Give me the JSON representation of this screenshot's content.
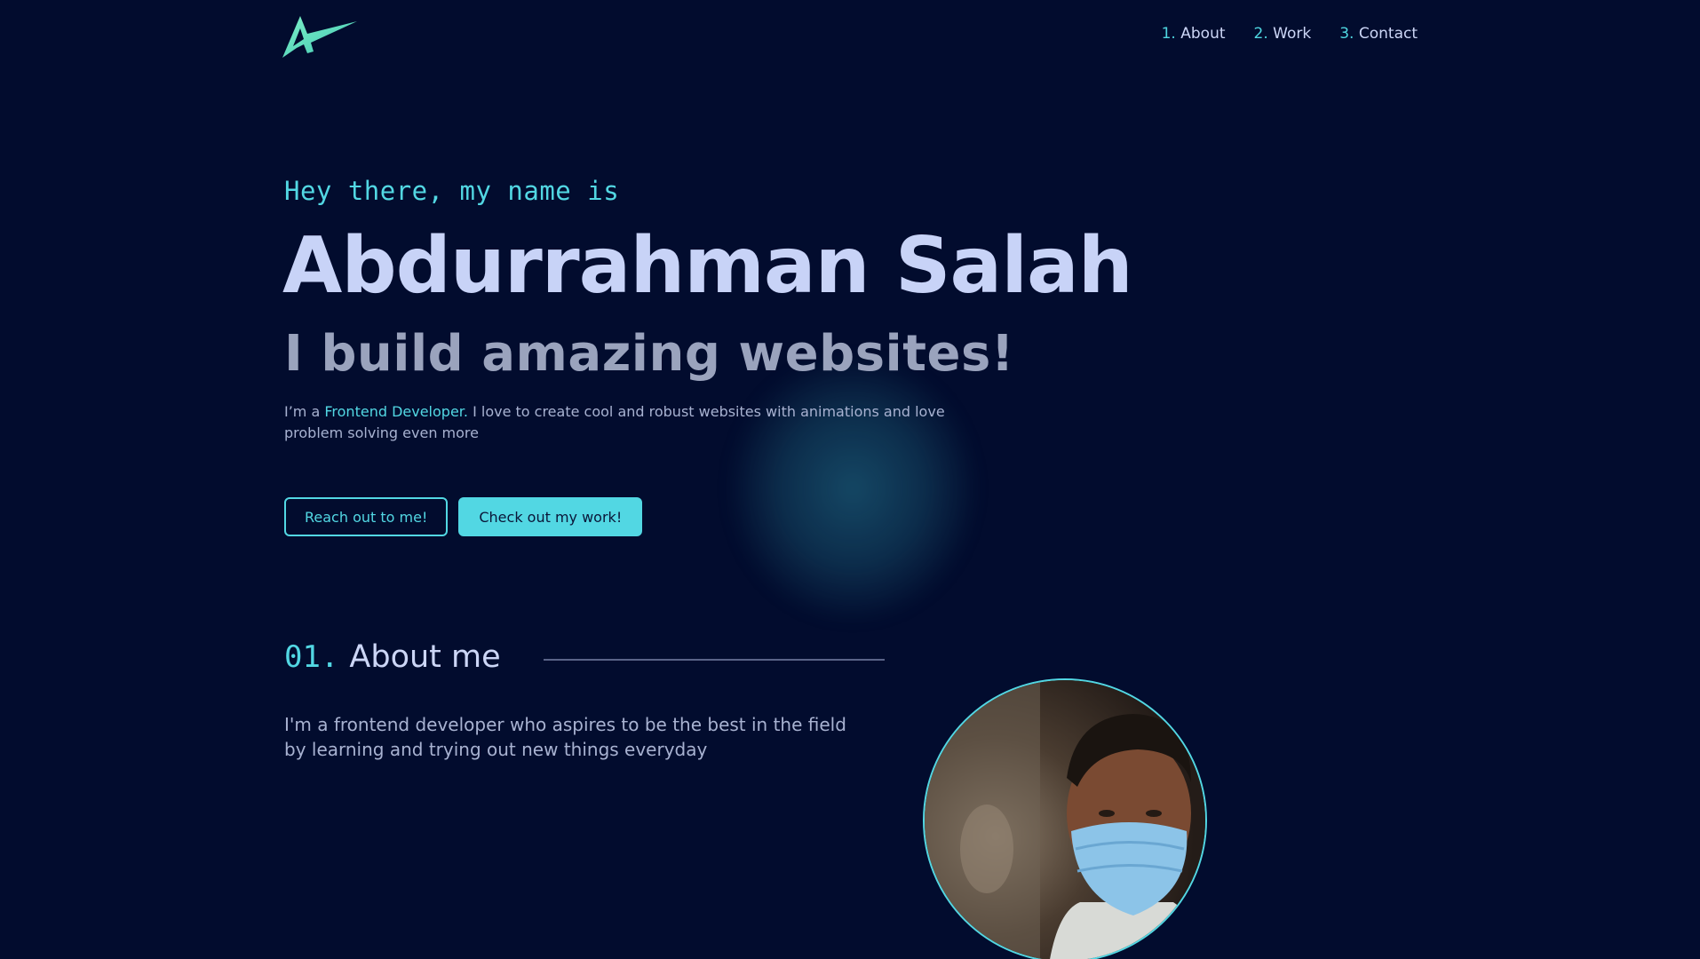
{
  "nav": {
    "items": [
      {
        "num": "1.",
        "label": "About"
      },
      {
        "num": "2.",
        "label": "Work"
      },
      {
        "num": "3.",
        "label": "Contact"
      }
    ]
  },
  "hero": {
    "greeting": "Hey there, my name is",
    "name": "Abdurrahman Salah",
    "tagline": "I build amazing websites!",
    "intro_before": "I’m a ",
    "intro_highlight": "Frontend Developer.",
    "intro_after": " I love to create cool and robust websites with animations and love problem solving even more",
    "buttons": {
      "reach_out": "Reach out to me!",
      "check_work": "Check out my work!"
    }
  },
  "about": {
    "number": "01.",
    "title": "About me",
    "text": "I'm a frontend developer who aspires to be the best in the field by learning and trying out new things everyday"
  },
  "colors": {
    "background": "#020c2e",
    "accent": "#52d7e3",
    "heading": "#c8d3f7",
    "muted": "#9aa3bd"
  },
  "icons": {
    "logo": "triangle-swoosh-logo-icon"
  }
}
